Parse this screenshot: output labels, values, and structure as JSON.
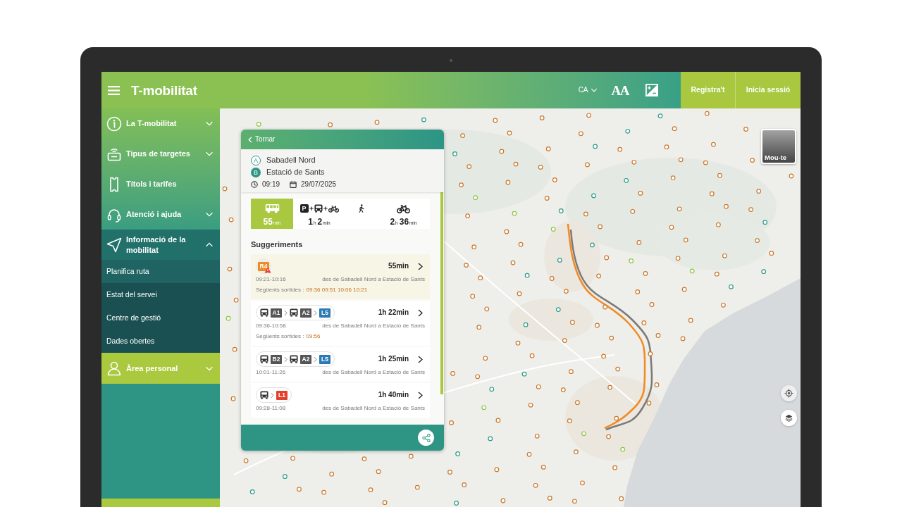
{
  "header": {
    "logo": "T-mobilitat",
    "language": "CA",
    "text_size_button": "AA",
    "buttons": [
      "Registra't",
      "Inicia sessió"
    ]
  },
  "sidebar": {
    "items": [
      {
        "label": "La T-mobilitat",
        "kind": "group",
        "expanded": false
      },
      {
        "label": "Tipus de targetes",
        "kind": "group",
        "expanded": false
      },
      {
        "label": "Títols i tarifes",
        "kind": "link"
      },
      {
        "label": "Atenció i ajuda",
        "kind": "group",
        "expanded": false
      },
      {
        "label": "Informació de la mobilitat",
        "kind": "group",
        "expanded": true,
        "children": [
          {
            "label": "Planifica ruta",
            "selected": true
          },
          {
            "label": "Estat del servei",
            "selected": false
          },
          {
            "label": "Centre de gestió",
            "selected": false
          },
          {
            "label": "Dades obertes",
            "selected": false
          }
        ]
      }
    ],
    "account": {
      "label": "Àrea personal",
      "expanded": false
    }
  },
  "map": {
    "move_button": "Mou-te"
  },
  "route_panel": {
    "back": "Tornar",
    "origin": {
      "marker": "A",
      "name": "Sabadell Nord"
    },
    "destination": {
      "marker": "B",
      "name": "Estació de Sants"
    },
    "time": "09:19",
    "date": "29/07/2025",
    "modes": [
      {
        "kind": "bus",
        "selected": true,
        "duration": [
          {
            "value": "55",
            "unit": "min"
          }
        ]
      },
      {
        "kind": "park_ride",
        "selected": false,
        "parking_sign": "P",
        "duration": [
          {
            "value": "1",
            "unit": "h"
          },
          {
            "value": "2",
            "unit": "min"
          }
        ]
      },
      {
        "kind": "walk",
        "selected": false
      },
      {
        "kind": "bike",
        "selected": false,
        "duration": [
          {
            "value": "2",
            "unit": "h"
          },
          {
            "value": "36",
            "unit": "min"
          }
        ]
      }
    ],
    "suggestions_title": "Suggeriments",
    "routes": [
      {
        "selected": true,
        "steps": [
          {
            "kind": "rail",
            "label": "R4",
            "color": "#f08a24",
            "alert": true
          }
        ],
        "duration": "55min",
        "times": "09:21-10:16",
        "description": "des de Sabadell Nord a Estació de Sants",
        "next_label": "Següents sortides :",
        "next_departures": "09:36 09:51 10:06 10:21"
      },
      {
        "selected": false,
        "steps": [
          {
            "kind": "bus",
            "label": "A1",
            "color": "#555555"
          },
          {
            "kind": "bus",
            "label": "A2",
            "color": "#555555"
          },
          {
            "kind": "metro",
            "label": "L5",
            "color": "#2a7ab5"
          }
        ],
        "duration": "1h 22min",
        "times": "09:36-10:58",
        "description": "des de Sabadell Nord a Estació de Sants",
        "next_label": "Següents sortides :",
        "next_departures": "09:56"
      },
      {
        "selected": false,
        "steps": [
          {
            "kind": "bus",
            "label": "B2",
            "color": "#555555"
          },
          {
            "kind": "bus",
            "label": "A2",
            "color": "#555555"
          },
          {
            "kind": "metro",
            "label": "L5",
            "color": "#2a7ab5"
          }
        ],
        "duration": "1h 25min",
        "times": "10:01-11:26",
        "description": "des de Sabadell Nord a Estació de Sants"
      },
      {
        "selected": false,
        "steps": [
          {
            "kind": "bus"
          },
          {
            "kind": "metro",
            "label": "L1",
            "color": "#e3412c"
          }
        ],
        "duration": "1h 40min",
        "times": "09:28-11:08",
        "description": "des de Sabadell Nord a Estació de Sants"
      }
    ]
  }
}
